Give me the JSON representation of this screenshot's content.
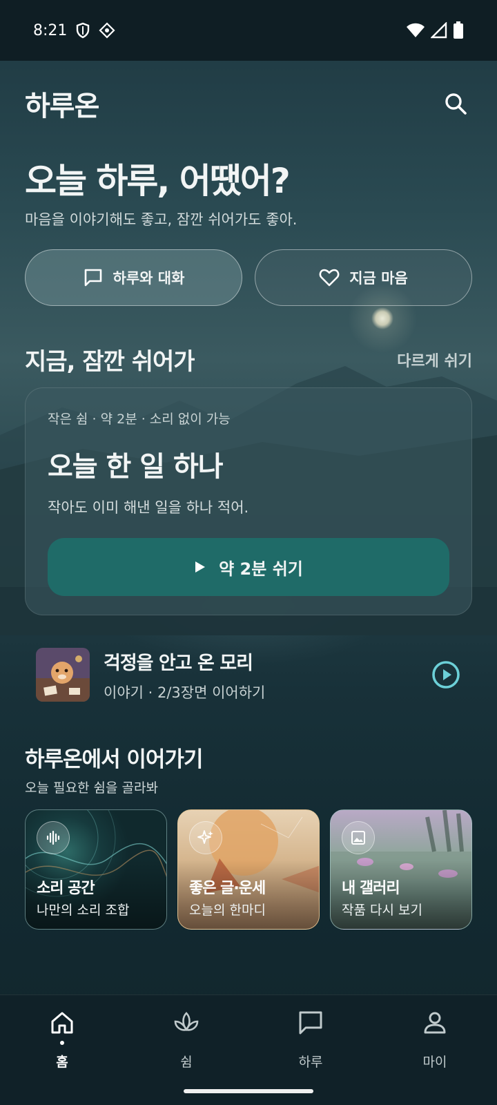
{
  "status": {
    "time": "8:21"
  },
  "app": {
    "title": "하루온"
  },
  "hero": {
    "headline": "오늘 하루, 어땠어?",
    "subline": "마음을 이야기해도 좋고, 잠깐 쉬어가도 좋아."
  },
  "actions": {
    "chat_label": "하루와 대화",
    "mood_label": "지금 마음"
  },
  "rest_section": {
    "title": "지금, 잠깐 쉬어가",
    "link": "다르게 쉬기",
    "card": {
      "meta": "작은 쉼 · 약 2분 · 소리 없이 가능",
      "title": "오늘 한 일 하나",
      "desc": "작아도 이미 해낸 일을 하나 적어.",
      "button": "약 2분 쉬기"
    }
  },
  "story": {
    "title": "걱정을 안고 온 모리",
    "sub": "이야기 · 2/3장면 이어하기"
  },
  "continue_section": {
    "title": "하루온에서 이어가기",
    "sub": "오늘 필요한 쉼을 골라봐",
    "tiles": [
      {
        "title": "소리 공간",
        "sub": "나만의 소리 조합",
        "icon": "sound-wave-icon"
      },
      {
        "title": "좋은 글·운세",
        "sub": "오늘의 한마디",
        "icon": "sparkle-icon"
      },
      {
        "title": "내 갤러리",
        "sub": "작품 다시 보기",
        "icon": "image-icon"
      }
    ]
  },
  "nav": {
    "items": [
      {
        "label": "홈",
        "icon": "home-icon",
        "active": true
      },
      {
        "label": "쉼",
        "icon": "leaf-icon",
        "active": false
      },
      {
        "label": "하루",
        "icon": "chat-icon",
        "active": false
      },
      {
        "label": "마이",
        "icon": "person-icon",
        "active": false
      }
    ]
  },
  "colors": {
    "accent": "#1f6b68",
    "play_icon": "#6cd0d8",
    "background": "#1d3740"
  }
}
